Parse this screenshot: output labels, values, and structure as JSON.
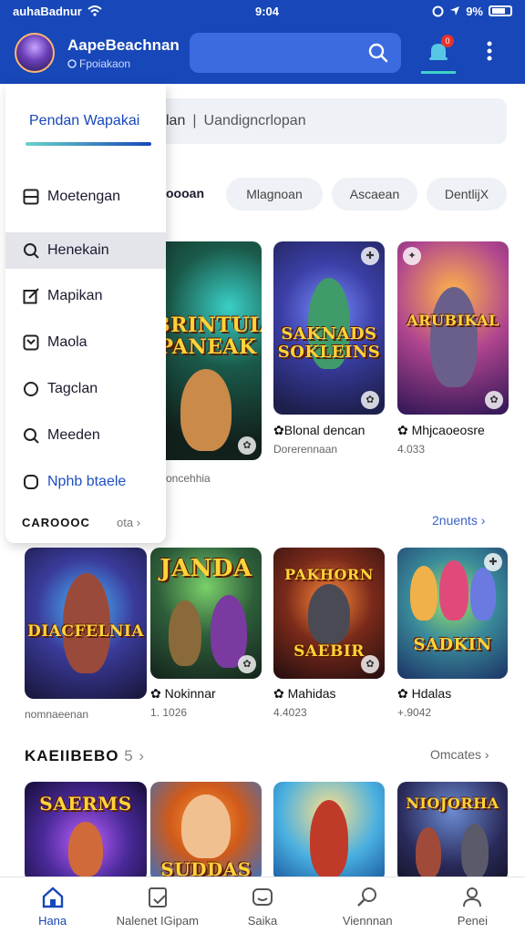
{
  "status_bar": {
    "carrier": "auhaBadnur",
    "time": "9:04",
    "battery": "9%"
  },
  "header": {
    "title": "AapeBeachnan",
    "subtitle": "Fpoiakaon",
    "notification_count": "0"
  },
  "dropdown": {
    "tab_label": "Pendan Wapakai",
    "items": [
      {
        "label": "Moetengan",
        "icon": "square-icon"
      },
      {
        "label": "Henekain",
        "icon": "search-icon"
      },
      {
        "label": "Mapikan",
        "icon": "edit-icon"
      },
      {
        "label": "Maola",
        "icon": "tag-icon"
      },
      {
        "label": "Tagclan",
        "icon": "circle-icon"
      },
      {
        "label": "Meeden",
        "icon": "search-icon"
      },
      {
        "label": "Nphb btaele",
        "icon": "circle-icon"
      }
    ],
    "footer_label": "CAROOOC",
    "footer_right": "ota"
  },
  "search": {
    "left_text": "lan",
    "placeholder": "Uandigncrlopan"
  },
  "chips": {
    "label": "oooan",
    "items": [
      "Mlagnoan",
      "Ascaean",
      "DentlijX"
    ]
  },
  "section1": {
    "cards": [
      {
        "art": "BRINTUIA PANEAK",
        "title": "",
        "meta": "oncehhia"
      },
      {
        "art": "SAKNADS SOKLEINS",
        "title": "Blonal dencan",
        "meta": "Dorerennaan"
      },
      {
        "art": "ARUBIKAL",
        "title": "Mhjcaoeosre",
        "meta": "4.033"
      }
    ]
  },
  "section2": {
    "see_all": "2nuents",
    "cards": [
      {
        "art": "DIACFELNIA",
        "title": "",
        "meta": "nomnaeenan"
      },
      {
        "art": "JANDA",
        "title": "Nokinnar",
        "meta": "1. 1026"
      },
      {
        "art": "SAEBIR",
        "art_top": "PAKHORN",
        "title": "Mahidas",
        "meta": "4.4023"
      },
      {
        "art": "SADKIN",
        "title": "Hdalas",
        "meta": "+.9042"
      }
    ]
  },
  "section3": {
    "title": "KAEIIBEBO",
    "count": "5",
    "see_all": "Omcates",
    "cards": [
      {
        "art": "SAERMS"
      },
      {
        "art": "SUDDAS"
      },
      {
        "art": ""
      },
      {
        "art": "NIOJORHA"
      }
    ]
  },
  "bottom_nav": [
    {
      "label": "Hana",
      "icon": "home-icon",
      "active": true
    },
    {
      "label": "Nalenet IGipam",
      "icon": "bookmark-icon",
      "active": false
    },
    {
      "label": "Saika",
      "icon": "chat-icon",
      "active": false
    },
    {
      "label": "Viennnan",
      "icon": "search-icon",
      "active": false
    },
    {
      "label": "Penei",
      "icon": "person-icon",
      "active": false
    }
  ],
  "colors": {
    "brand_blue": "#1747b8",
    "accent_teal": "#3fd2c7",
    "link_blue": "#3d62c6"
  }
}
